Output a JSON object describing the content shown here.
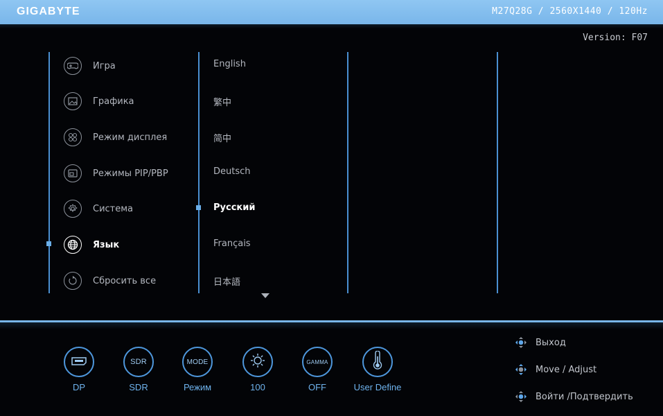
{
  "header": {
    "brand": "GIGABYTE",
    "model_info": "M27Q28G / 2560X1440 / 120Hz"
  },
  "version": "Version: F07",
  "menu": {
    "items": [
      {
        "label": "Игра",
        "icon": "gamepad-icon"
      },
      {
        "label": "Графика",
        "icon": "picture-icon"
      },
      {
        "label": "Режим дисплея",
        "icon": "display-mode-icon"
      },
      {
        "label": "Режимы PIP/PBP",
        "icon": "pip-icon"
      },
      {
        "label": "Система",
        "icon": "gear-icon"
      },
      {
        "label": "Язык",
        "icon": "globe-icon",
        "active": true
      },
      {
        "label": "Сбросить все",
        "icon": "reset-icon"
      }
    ]
  },
  "languages": {
    "items": [
      "English",
      "繁中",
      "简中",
      "Deutsch",
      "Русский",
      "Français",
      "日本語"
    ],
    "selected": "Русский"
  },
  "quick_bar": [
    {
      "icon_text": "",
      "icon": "dp-port-icon",
      "label": "DP"
    },
    {
      "icon_text": "SDR",
      "icon": "sdr-icon",
      "label": "SDR"
    },
    {
      "icon_text": "MODE",
      "icon": "mode-icon",
      "label": "Режим"
    },
    {
      "icon_text": "",
      "icon": "brightness-icon",
      "label": "100"
    },
    {
      "icon_text": "GAMMA",
      "icon": "gamma-icon",
      "label": "OFF"
    },
    {
      "icon_text": "",
      "icon": "thermometer-icon",
      "label": "User Define"
    }
  ],
  "hints": [
    {
      "label": "Выход",
      "icon": "joystick-left-icon"
    },
    {
      "label": "Move / Adjust",
      "icon": "joystick-move-icon"
    },
    {
      "label": "Войти /Подтвердить",
      "icon": "joystick-press-icon"
    }
  ],
  "colors": {
    "accent": "#79b6ea",
    "divider": "#4a8fd1",
    "background": "#030407"
  }
}
